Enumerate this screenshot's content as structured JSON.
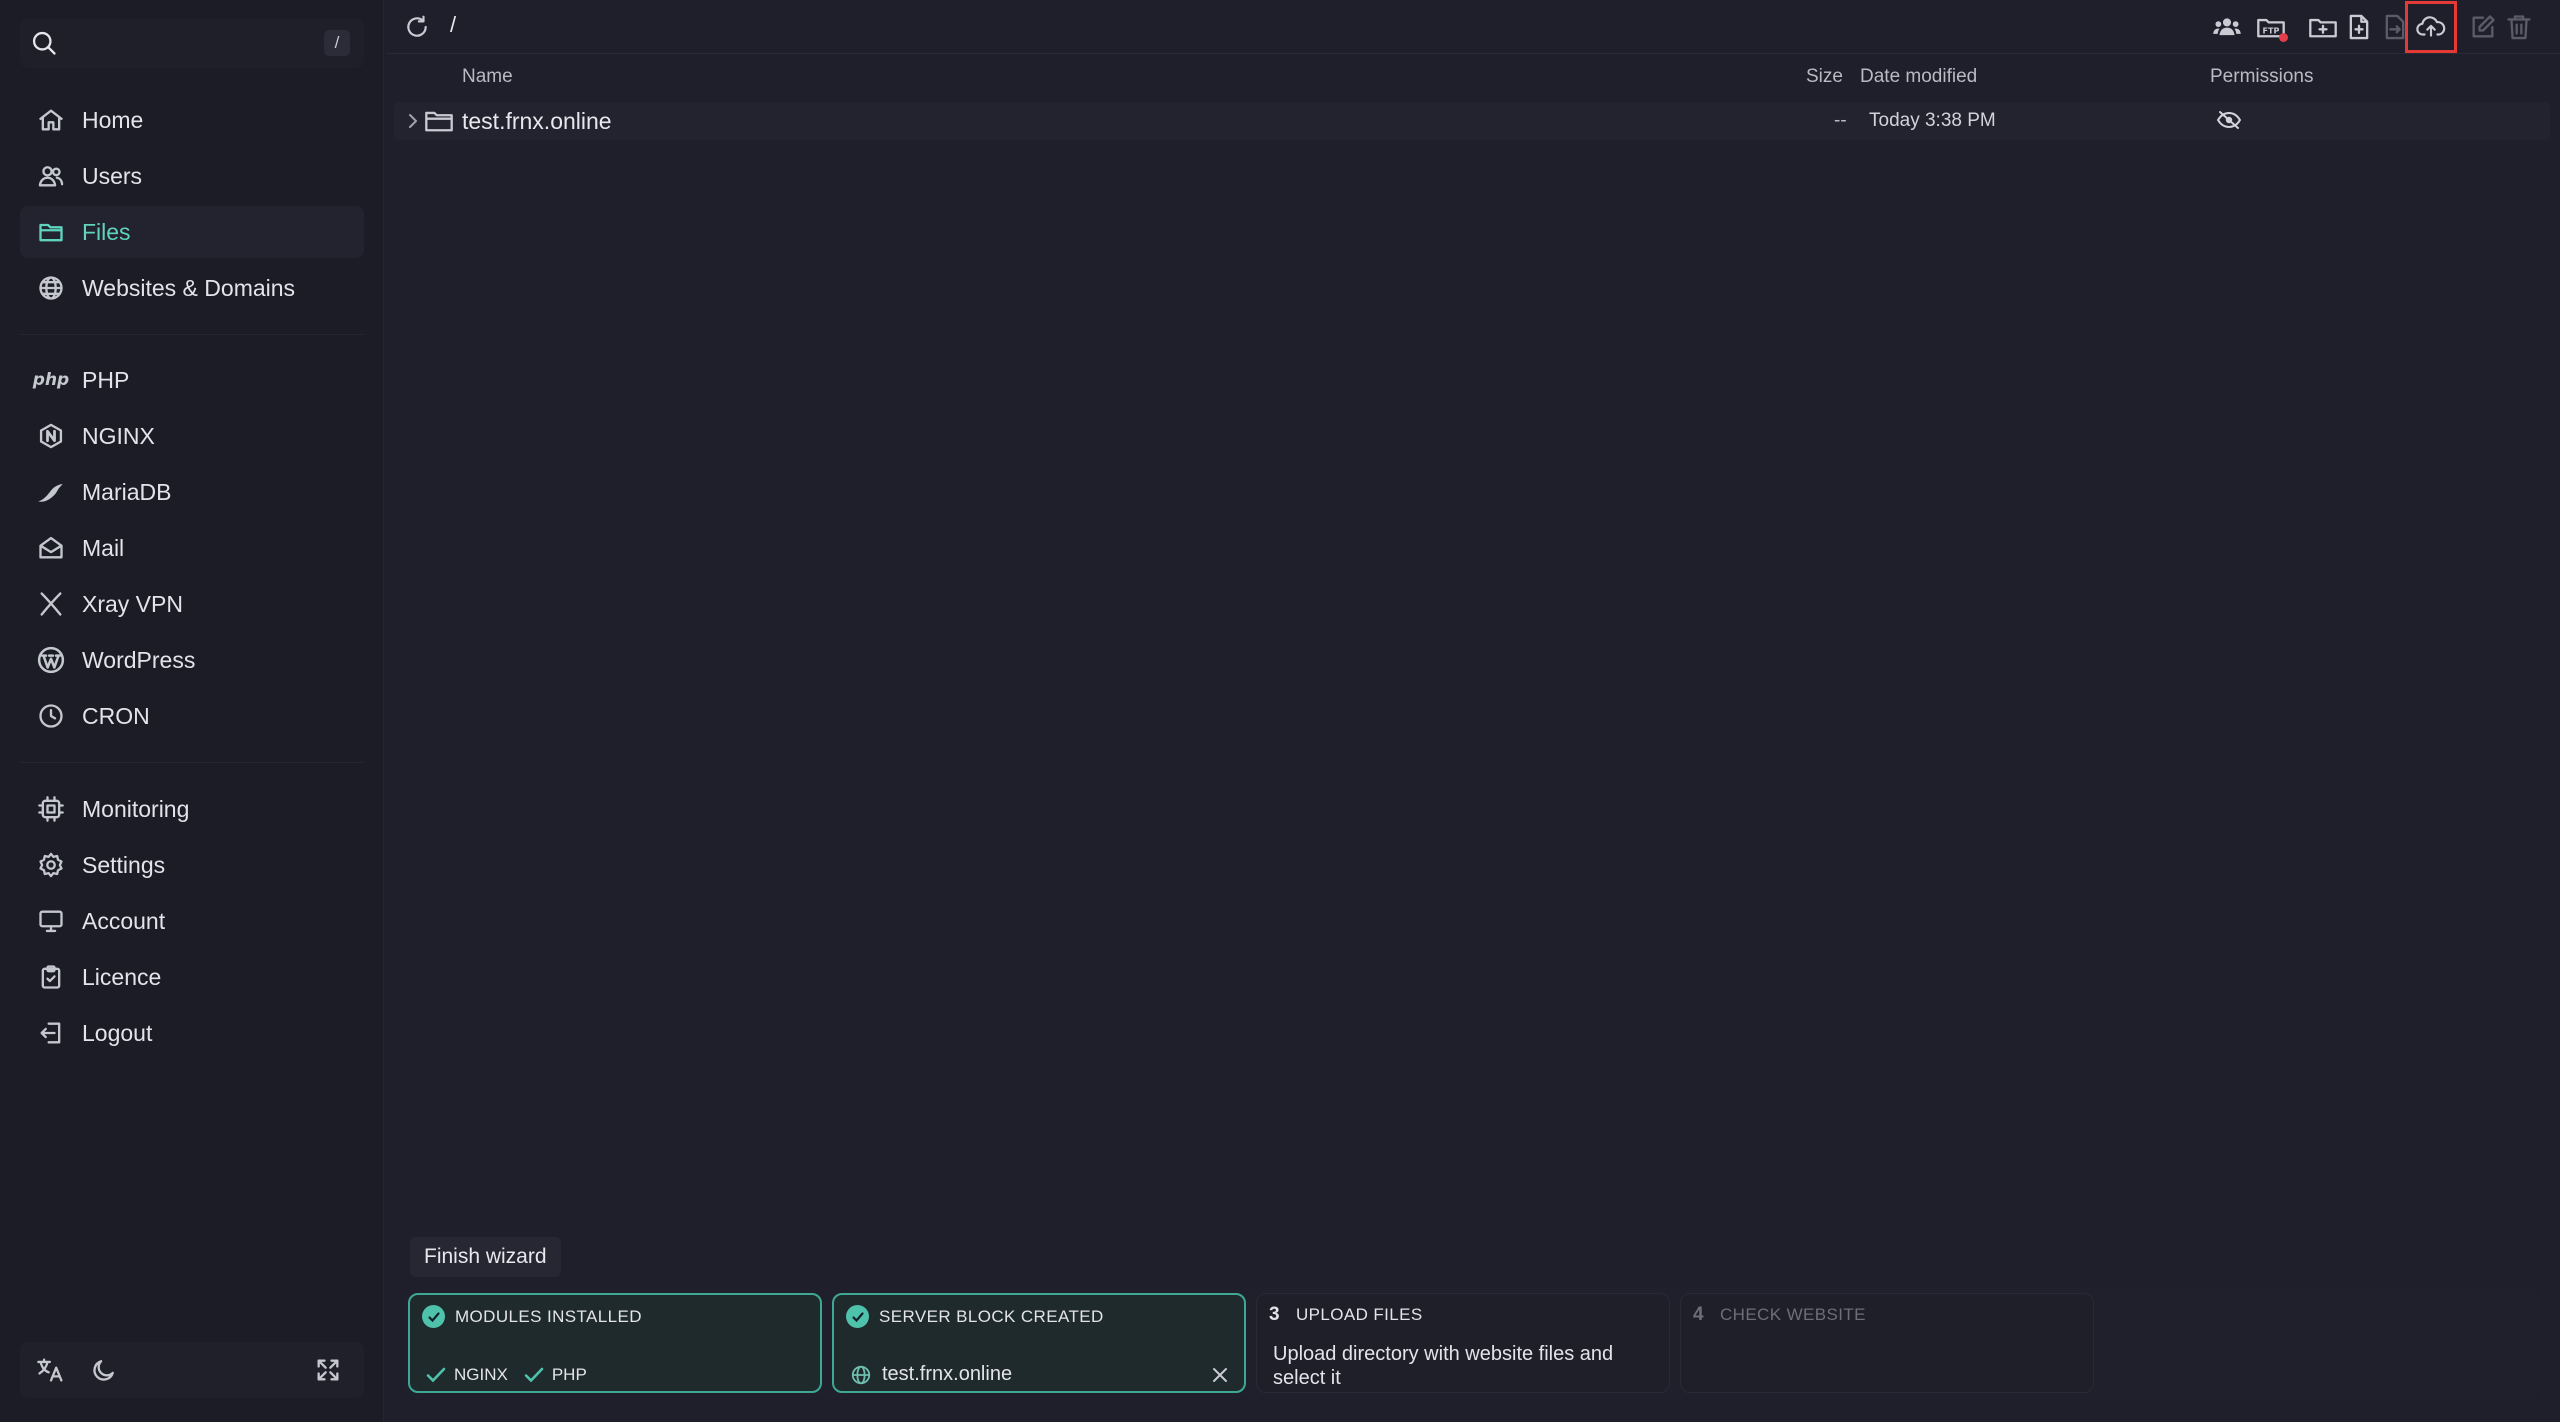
{
  "search": {
    "shortcut": "/"
  },
  "sidebar": {
    "primary": [
      {
        "label": "Home",
        "icon": "home-icon"
      },
      {
        "label": "Users",
        "icon": "users-icon"
      },
      {
        "label": "Files",
        "icon": "folder-icon",
        "active": true
      },
      {
        "label": "Websites & Domains",
        "icon": "globe-icon"
      }
    ],
    "services": [
      {
        "label": "PHP",
        "icon": "php-icon",
        "logo_text": "php"
      },
      {
        "label": "NGINX",
        "icon": "nginx-icon"
      },
      {
        "label": "MariaDB",
        "icon": "mariadb-icon"
      },
      {
        "label": "Mail",
        "icon": "mail-icon"
      },
      {
        "label": "Xray VPN",
        "icon": "xray-icon"
      },
      {
        "label": "WordPress",
        "icon": "wordpress-icon"
      },
      {
        "label": "CRON",
        "icon": "clock-icon"
      }
    ],
    "system": [
      {
        "label": "Monitoring",
        "icon": "cpu-icon"
      },
      {
        "label": "Settings",
        "icon": "gear-icon"
      },
      {
        "label": "Account",
        "icon": "monitor-icon"
      },
      {
        "label": "Licence",
        "icon": "clipboard-icon"
      },
      {
        "label": "Logout",
        "icon": "logout-icon"
      }
    ]
  },
  "files": {
    "path": "/",
    "columns": {
      "name": "Name",
      "size": "Size",
      "date": "Date modified",
      "permissions": "Permissions"
    },
    "rows": [
      {
        "name": "test.frnx.online",
        "size": "--",
        "date": "Today 3:38 PM"
      }
    ]
  },
  "wizard": {
    "label": "Finish wizard",
    "steps": [
      {
        "title": "MODULES INSTALLED",
        "modules": [
          "NGINX",
          "PHP"
        ]
      },
      {
        "title": "SERVER BLOCK CREATED",
        "domain": "test.frnx.online"
      },
      {
        "number": "3",
        "title": "UPLOAD FILES",
        "description": "Upload directory with website files and select it"
      },
      {
        "number": "4",
        "title": "CHECK WEBSITE"
      }
    ]
  },
  "colors": {
    "accent": "#5fd3bd",
    "highlight": "#e53935",
    "background": "#1f1f2b"
  }
}
